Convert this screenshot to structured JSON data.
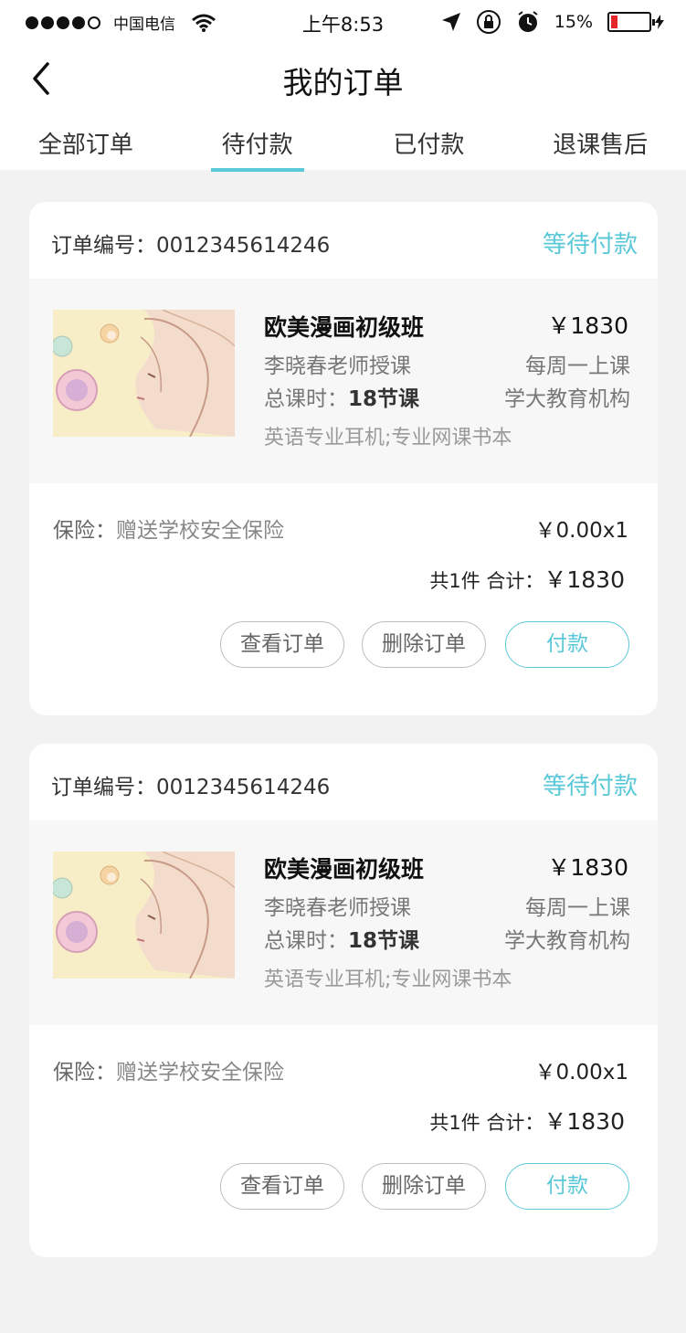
{
  "status_bar": {
    "carrier": "中国电信",
    "time": "上午8:53",
    "battery_percent": "15%",
    "battery_level": 0.15,
    "signal_bars": 4,
    "icons": [
      "signal-dots-icon",
      "wifi-icon",
      "location-arrow-icon",
      "rotation-lock-icon",
      "alarm-icon",
      "battery-icon",
      "charging-bolt-icon"
    ]
  },
  "nav": {
    "title": "我的订单",
    "back_icon": "chevron-left-icon"
  },
  "tabs": [
    {
      "label": "全部订单",
      "active": false
    },
    {
      "label": "待付款",
      "active": true
    },
    {
      "label": "已付款",
      "active": false
    },
    {
      "label": "退课售后",
      "active": false
    }
  ],
  "accent_color": "#5bc8d8",
  "orders": [
    {
      "order_label": "订单编号：0012345614246",
      "status": "等待付款",
      "product": {
        "title": "欧美漫画初级班",
        "price": "￥1830",
        "teacher": "李晓春老师授课",
        "frequency": "每周一上课",
        "hours_label": "总课时：",
        "hours_value": "18节课",
        "org": "学大教育机构",
        "extras": "英语专业耳机;专业网课书本"
      },
      "insurance_label": "保险：",
      "insurance_value": "赠送学校安全保险",
      "insurance_price": "￥0.00x1",
      "total_prefix": "共1件 合计：",
      "total_amount": "￥1830",
      "buttons": {
        "view": "查看订单",
        "delete": "删除订单",
        "pay": "付款"
      }
    },
    {
      "order_label": "订单编号：0012345614246",
      "status": "等待付款",
      "product": {
        "title": "欧美漫画初级班",
        "price": "￥1830",
        "teacher": "李晓春老师授课",
        "frequency": "每周一上课",
        "hours_label": "总课时：",
        "hours_value": "18节课",
        "org": "学大教育机构",
        "extras": "英语专业耳机;专业网课书本"
      },
      "insurance_label": "保险：",
      "insurance_value": "赠送学校安全保险",
      "insurance_price": "￥0.00x1",
      "total_prefix": "共1件 合计：",
      "total_amount": "￥1830",
      "buttons": {
        "view": "查看订单",
        "delete": "删除订单",
        "pay": "付款"
      }
    }
  ]
}
